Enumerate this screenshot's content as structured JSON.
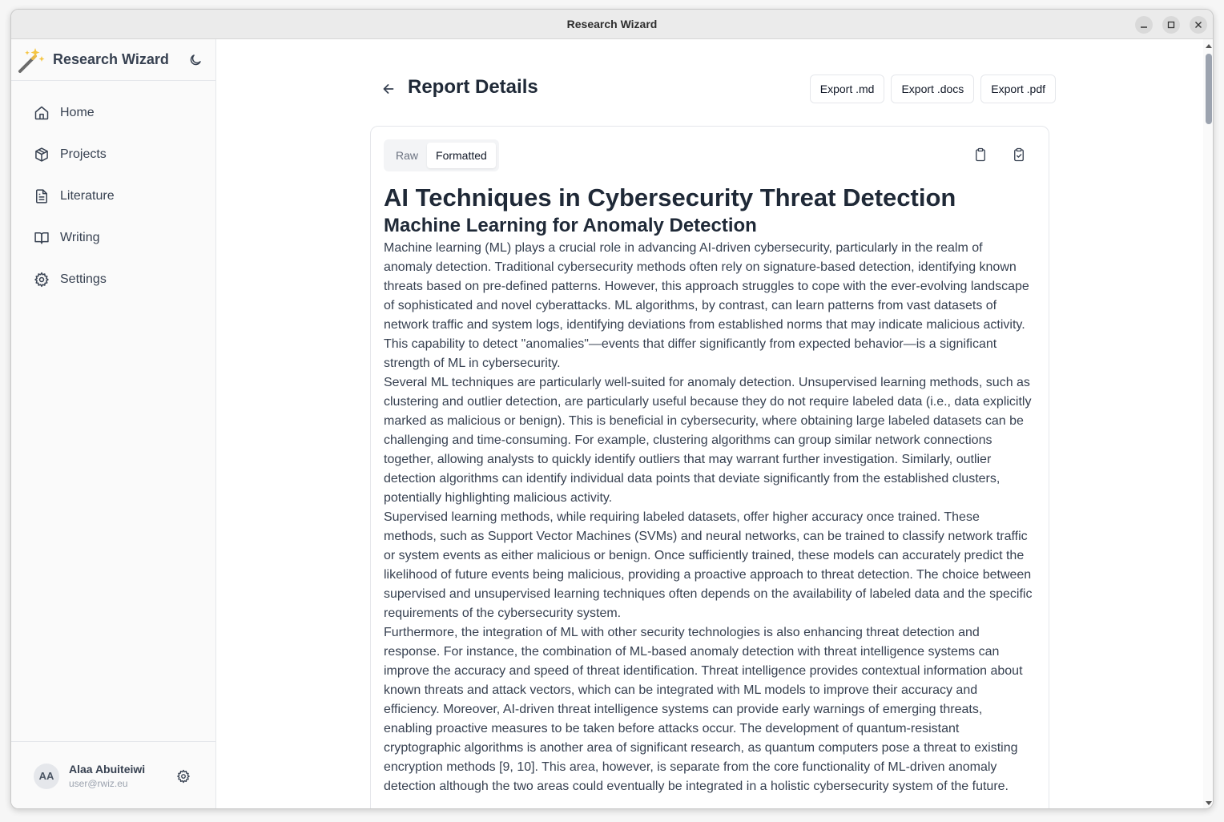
{
  "window": {
    "title": "Research Wizard"
  },
  "sidebar": {
    "brand": "Research Wizard",
    "items": [
      {
        "label": "Home",
        "icon": "home-icon"
      },
      {
        "label": "Projects",
        "icon": "cube-icon"
      },
      {
        "label": "Literature",
        "icon": "document-icon"
      },
      {
        "label": "Writing",
        "icon": "book-open-icon"
      },
      {
        "label": "Settings",
        "icon": "gear-icon"
      }
    ],
    "user": {
      "initials": "AA",
      "name": "Alaa Abuiteiwi",
      "email": "user@rwiz.eu"
    }
  },
  "header": {
    "title": "Report Details",
    "export_md": "Export .md",
    "export_docs": "Export .docs",
    "export_pdf": "Export .pdf"
  },
  "tabs": {
    "raw": "Raw",
    "formatted": "Formatted",
    "active": "Formatted"
  },
  "report": {
    "title": "AI Techniques in Cybersecurity Threat Detection",
    "section_title": "Machine Learning for Anomaly Detection",
    "paragraphs": [
      "Machine learning (ML) plays a crucial role in advancing AI-driven cybersecurity, particularly in the realm of anomaly detection. Traditional cybersecurity methods often rely on signature-based detection, identifying known threats based on pre-defined patterns. However, this approach struggles to cope with the ever-evolving landscape of sophisticated and novel cyberattacks. ML algorithms, by contrast, can learn patterns from vast datasets of network traffic and system logs, identifying deviations from established norms that may indicate malicious activity. This capability to detect \"anomalies\"—events that differ significantly from expected behavior—is a significant strength of ML in cybersecurity.",
      "Several ML techniques are particularly well-suited for anomaly detection. Unsupervised learning methods, such as clustering and outlier detection, are particularly useful because they do not require labeled data (i.e., data explicitly marked as malicious or benign). This is beneficial in cybersecurity, where obtaining large labeled datasets can be challenging and time-consuming. For example, clustering algorithms can group similar network connections together, allowing analysts to quickly identify outliers that may warrant further investigation. Similarly, outlier detection algorithms can identify individual data points that deviate significantly from the established clusters, potentially highlighting malicious activity.",
      "Supervised learning methods, while requiring labeled datasets, offer higher accuracy once trained. These methods, such as Support Vector Machines (SVMs) and neural networks, can be trained to classify network traffic or system events as either malicious or benign. Once sufficiently trained, these models can accurately predict the likelihood of future events being malicious, providing a proactive approach to threat detection. The choice between supervised and unsupervised learning techniques often depends on the availability of labeled data and the specific requirements of the cybersecurity system.",
      "Furthermore, the integration of ML with other security technologies is also enhancing threat detection and response. For instance, the combination of ML-based anomaly detection with threat intelligence systems can improve the accuracy and speed of threat identification. Threat intelligence provides contextual information about known threats and attack vectors, which can be integrated with ML models to improve their accuracy and efficiency. Moreover, AI-driven threat intelligence systems can provide early warnings of emerging threats, enabling proactive measures to be taken before attacks occur. The development of quantum-resistant cryptographic algorithms is another area of significant research, as quantum computers pose a threat to existing encryption methods [9, 10]. This area, however, is separate from the core functionality of ML-driven anomaly detection although the two areas could eventually be integrated in a holistic cybersecurity system of the future."
    ]
  },
  "colors": {
    "accent": "#374151",
    "border": "#e5e7eb",
    "sidebar_bg": "#fafafa"
  }
}
